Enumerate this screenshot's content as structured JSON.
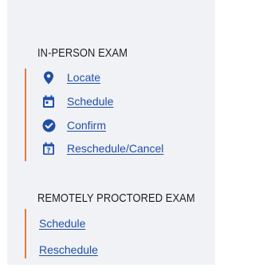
{
  "in_person": {
    "heading": "IN-PERSON EXAM",
    "links": [
      {
        "label": "Locate",
        "icon": "location-pin-icon"
      },
      {
        "label": "Schedule",
        "icon": "calendar-icon"
      },
      {
        "label": "Confirm",
        "icon": "check-circle-icon"
      },
      {
        "label": "Reschedule/Cancel",
        "icon": "calendar-question-icon"
      }
    ]
  },
  "remote": {
    "heading": "REMOTELY PROCTORED EXAM",
    "links": [
      {
        "label": "Schedule"
      },
      {
        "label": "Reschedule"
      }
    ]
  },
  "colors": {
    "panel_background": "#f1f2f5",
    "accent_bar": "#e8763e",
    "link": "#1f4fa6",
    "icon": "#1f4fa6",
    "heading": "#1b1f26"
  }
}
